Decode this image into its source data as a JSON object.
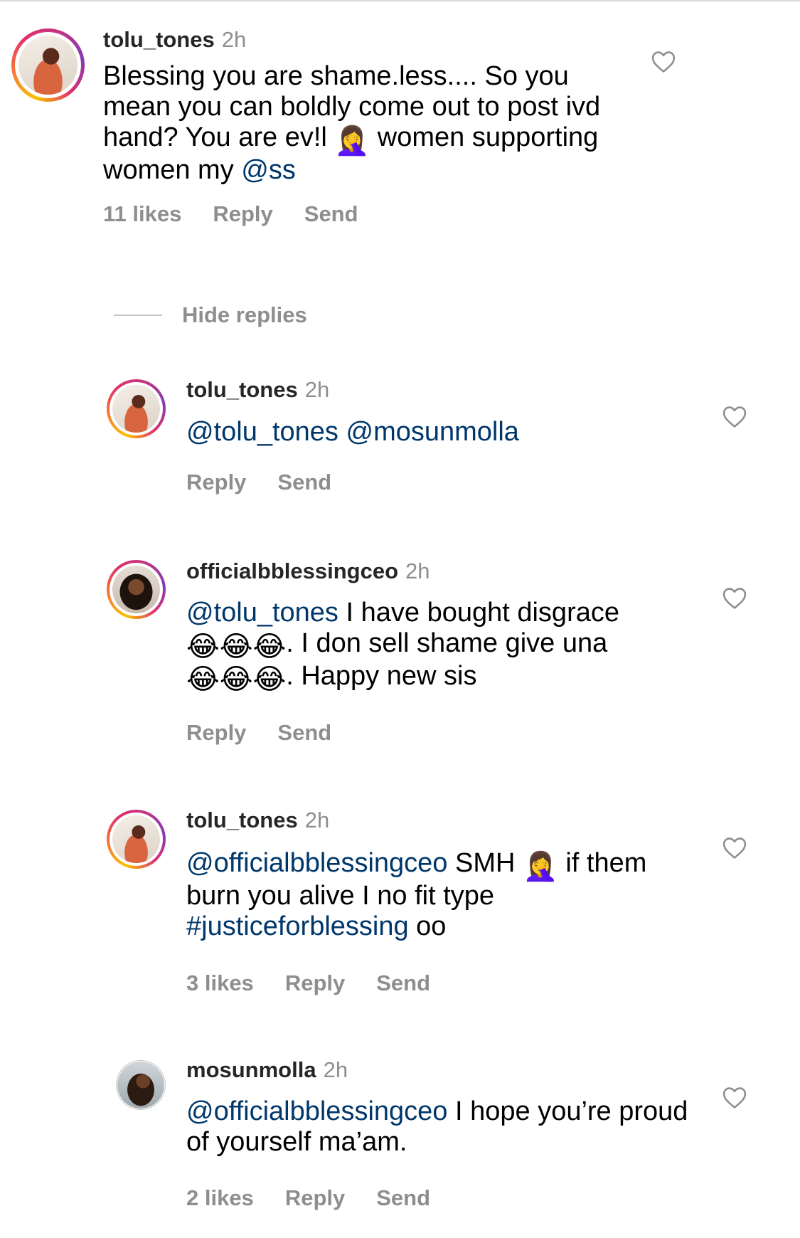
{
  "colors": {
    "mention": "#00376b",
    "muted": "#8e8e8e",
    "username": "#262626"
  },
  "comments": [
    {
      "username": "tolu_tones",
      "time": "2h",
      "text": {
        "t1": "Blessing you are shame.less.... So you mean you can boldly come out to post ivd hand? You are ev!l ",
        "emoji": "🤦‍♀️",
        "t2": " women supporting women my ",
        "m1": "@ss"
      },
      "likes": "11 likes",
      "reply": "Reply",
      "send": "Send"
    }
  ],
  "hide_replies": "Hide replies",
  "replies": [
    {
      "username": "tolu_tones",
      "time": "2h",
      "text": {
        "m1": "@tolu_tones",
        "m2": "@mosunmolla"
      },
      "reply": "Reply",
      "send": "Send"
    },
    {
      "username": "officialbblessingceo",
      "time": "2h",
      "text": {
        "m1": "@tolu_tones",
        "t1": " I have bought disgrace ",
        "e1": "😂😂😂",
        "t2": ". I don sell shame give una ",
        "e2": "😂😂😂",
        "t3": ". Happy new sis"
      },
      "reply": "Reply",
      "send": "Send"
    },
    {
      "username": "tolu_tones",
      "time": "2h",
      "text": {
        "m1": "@officialbblessingceo",
        "t1": " SMH ",
        "emoji": "🤦‍♀️",
        "t2": " if them burn you alive I no fit type ",
        "m2": "#justiceforblessing",
        "t3": " oo"
      },
      "likes": "3 likes",
      "reply": "Reply",
      "send": "Send"
    },
    {
      "username": "mosunmolla",
      "time": "2h",
      "text": {
        "m1": "@officialbblessingceo",
        "t1": " I hope you’re proud of yourself ma’am."
      },
      "likes": "2 likes",
      "reply": "Reply",
      "send": "Send"
    }
  ],
  "icons": {
    "like": "heart-outline-icon"
  }
}
